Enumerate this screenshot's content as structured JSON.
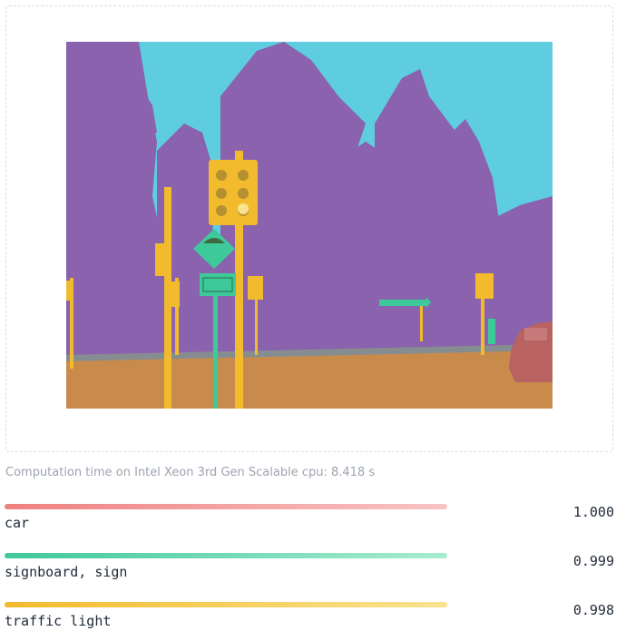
{
  "computation_text": "Computation time on Intel Xeon 3rd Gen Scalable cpu: 8.418 s",
  "colors": {
    "car": [
      "#ef8080",
      "#f8c4c4"
    ],
    "signboard": [
      "#3ec99a",
      "#a8ecd1"
    ],
    "traffic_light": [
      "#f2bb2d",
      "#f9e38f"
    ],
    "sky": "#5fcde0",
    "tree": "#8a62ad",
    "road": "#c98b4c"
  },
  "labels": [
    {
      "name": "car",
      "score": "1.000",
      "confidence": 1.0
    },
    {
      "name": "signboard, sign",
      "score": "0.999",
      "confidence": 0.999
    },
    {
      "name": "traffic light",
      "score": "0.998",
      "confidence": 0.998
    }
  ]
}
